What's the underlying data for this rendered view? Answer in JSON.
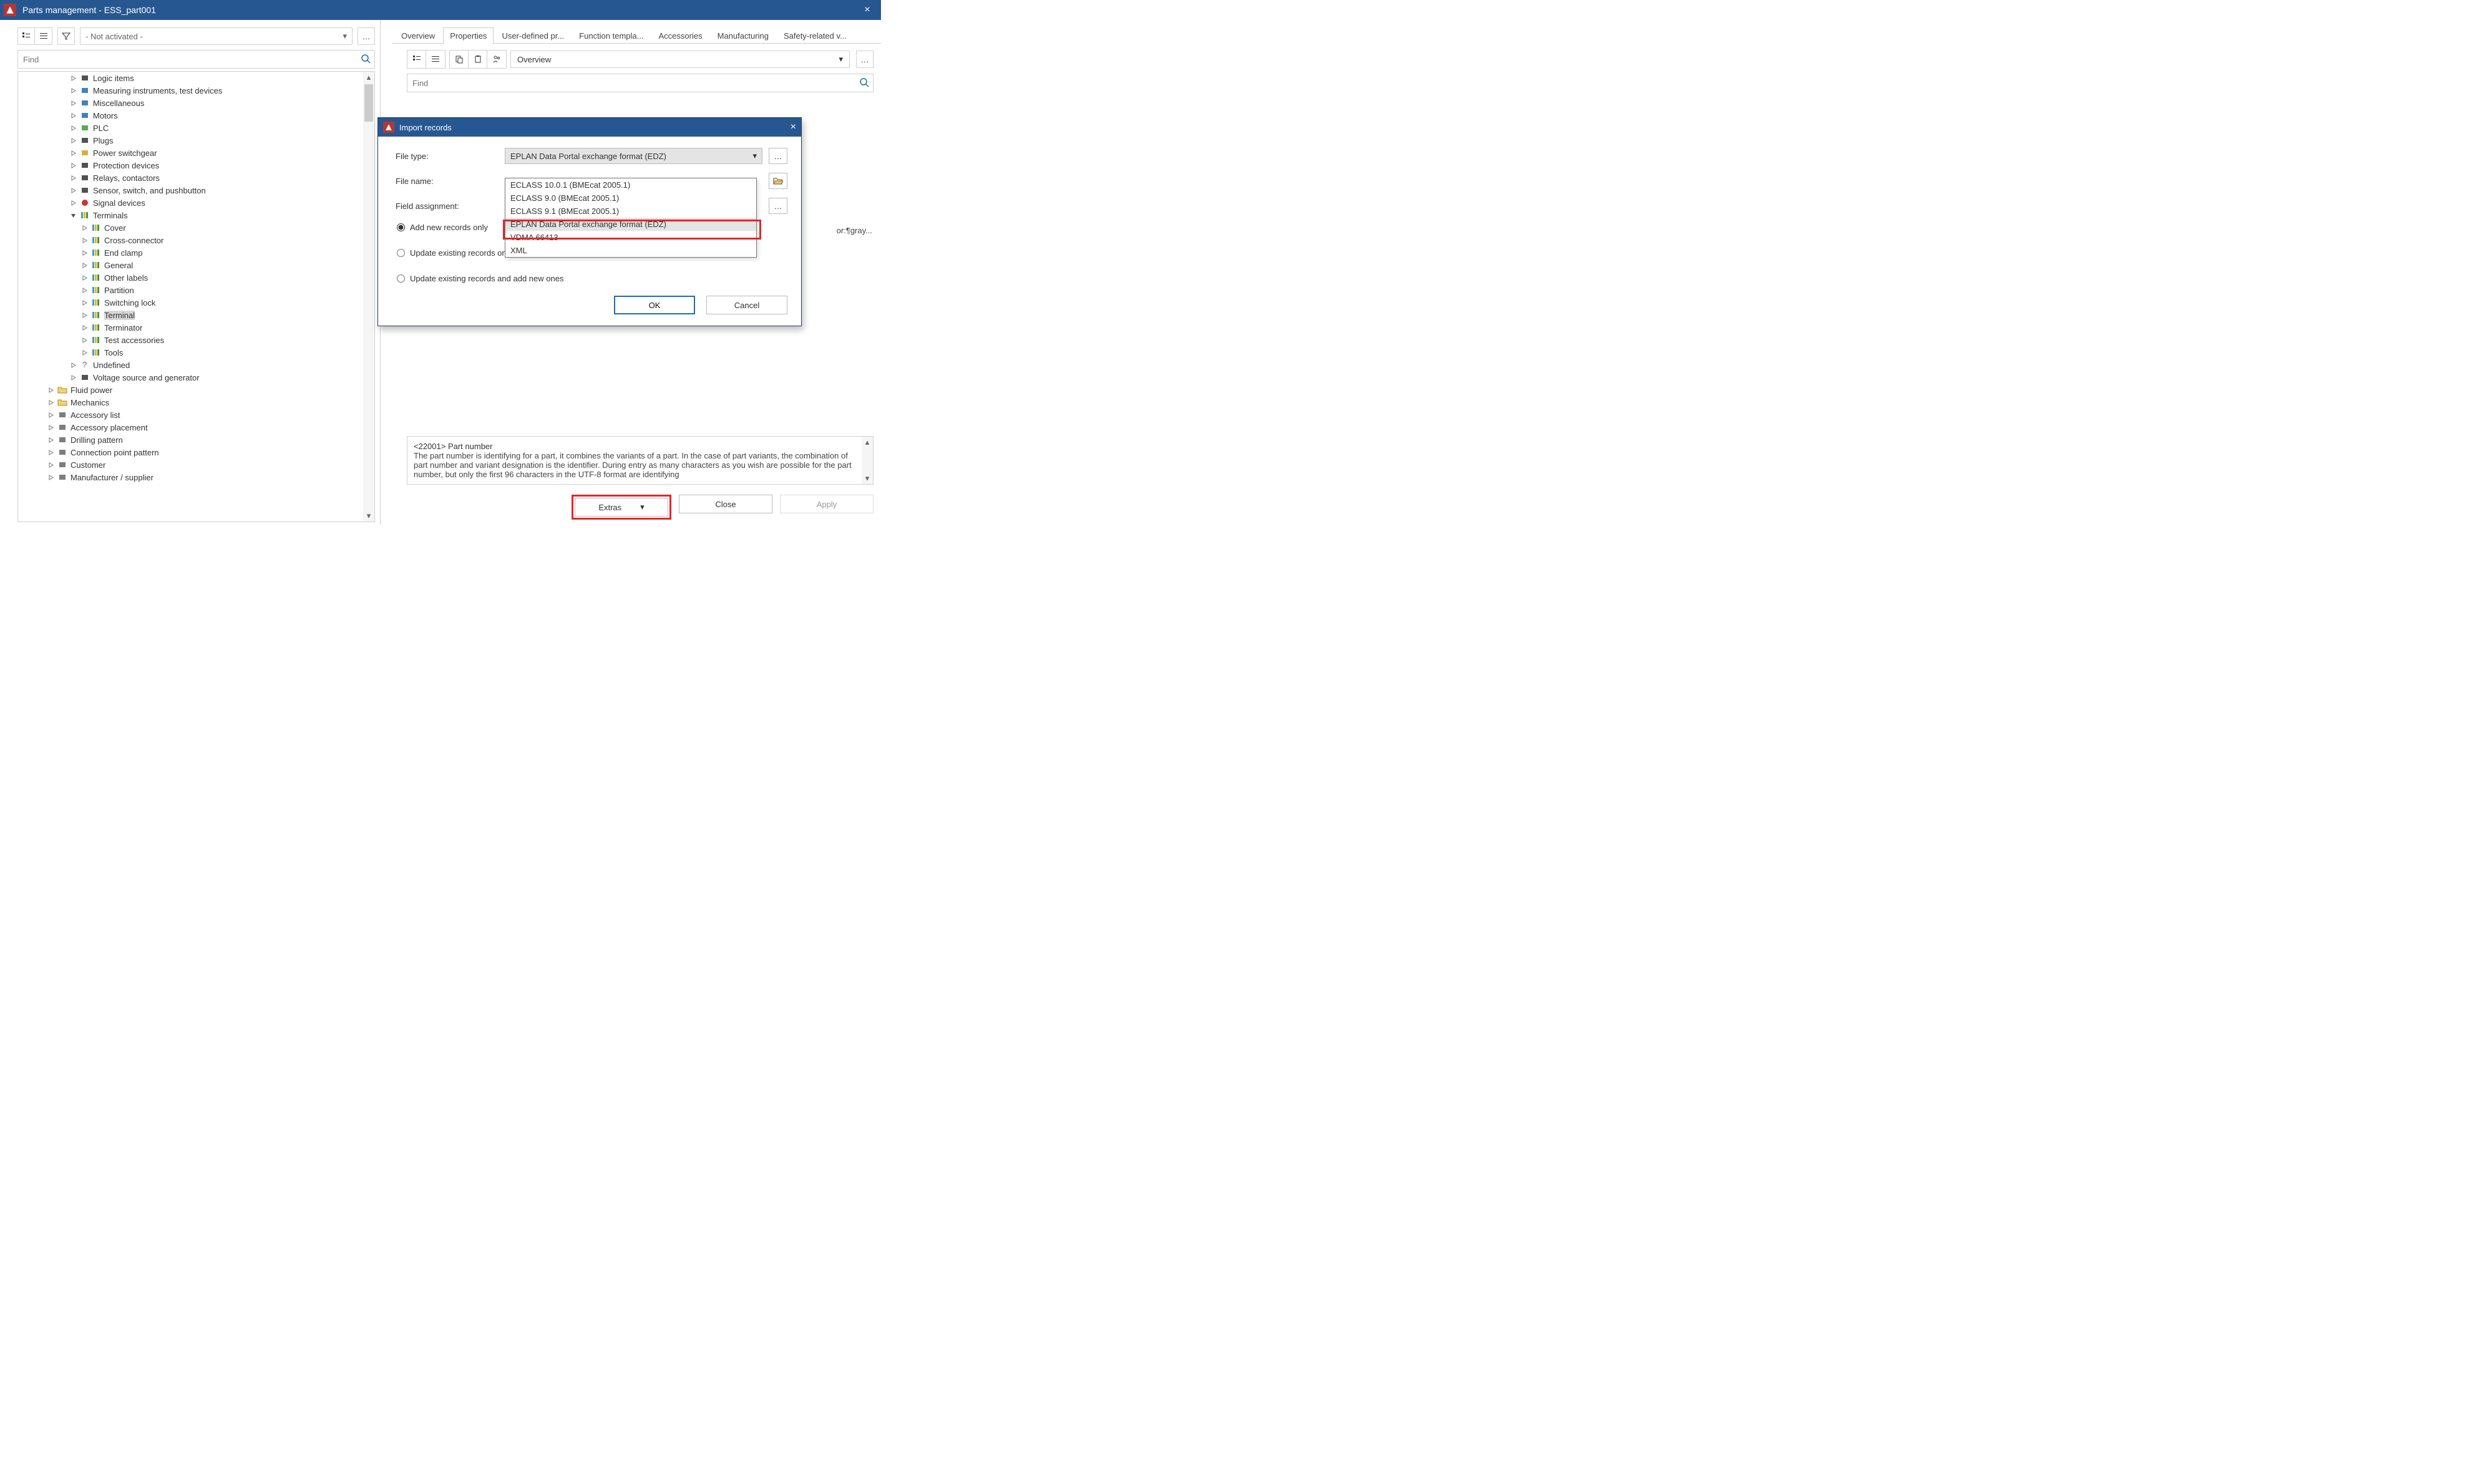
{
  "window": {
    "title": "Parts management - ESS_part001"
  },
  "left": {
    "filter_placeholder": "- Not activated -",
    "find_placeholder": "Find",
    "tree": [
      {
        "label": "Logic items",
        "icon": "logic"
      },
      {
        "label": "Measuring instruments, test devices",
        "icon": "measure"
      },
      {
        "label": "Miscellaneous",
        "icon": "misc"
      },
      {
        "label": "Motors",
        "icon": "motor"
      },
      {
        "label": "PLC",
        "icon": "plc"
      },
      {
        "label": "Plugs",
        "icon": "plug"
      },
      {
        "label": "Power switchgear",
        "icon": "switchgear"
      },
      {
        "label": "Protection devices",
        "icon": "protect"
      },
      {
        "label": "Relays, contactors",
        "icon": "relay"
      },
      {
        "label": "Sensor, switch, and pushbutton",
        "icon": "sensor"
      },
      {
        "label": "Signal devices",
        "icon": "signal"
      },
      {
        "label": "Terminals",
        "icon": "terminals",
        "expanded": true,
        "children": [
          {
            "label": "Cover"
          },
          {
            "label": "Cross-connector"
          },
          {
            "label": "End clamp"
          },
          {
            "label": "General"
          },
          {
            "label": "Other labels"
          },
          {
            "label": "Partition"
          },
          {
            "label": "Switching lock"
          },
          {
            "label": "Terminal",
            "selected": true
          },
          {
            "label": "Terminator"
          },
          {
            "label": "Test accessories"
          },
          {
            "label": "Tools"
          }
        ]
      },
      {
        "label": "Undefined",
        "icon": "undefined"
      },
      {
        "label": "Voltage source and generator",
        "icon": "voltage"
      }
    ],
    "tree_tail": [
      {
        "label": "Fluid power",
        "icon": "folder"
      },
      {
        "label": "Mechanics",
        "icon": "folder"
      },
      {
        "label": "Accessory list",
        "icon": "acclist"
      },
      {
        "label": "Accessory placement",
        "icon": "accplace"
      },
      {
        "label": "Drilling pattern",
        "icon": "drill"
      },
      {
        "label": "Connection point pattern",
        "icon": "connpt"
      },
      {
        "label": "Customer",
        "icon": "customer"
      },
      {
        "label": "Manufacturer / supplier",
        "icon": "manuf"
      }
    ]
  },
  "right": {
    "tabs": [
      "Overview",
      "Properties",
      "User-defined pr...",
      "Function templa...",
      "Accessories",
      "Manufacturing",
      "Safety-related v..."
    ],
    "active_tab": 1,
    "overview_dd": "Overview",
    "find_placeholder": "Find",
    "truncated_text": "or:¶gray...",
    "info_title": "<22001> Part number",
    "info_body": "The part number is identifying for a part, it combines the variants of a part. In the case of part variants, the combination of part number and variant designation is the identifier. During entry as many characters as you wish are possible for the part number, but only the first 96 characters in the UTF-8 format are identifying",
    "buttons": {
      "extras": "Extras",
      "close": "Close",
      "apply": "Apply"
    }
  },
  "modal": {
    "title": "Import records",
    "labels": {
      "file_type": "File type:",
      "file_name": "File name:",
      "field_assignment": "Field assignment:"
    },
    "file_type_value": "EPLAN Data Portal exchange format (EDZ)",
    "options": [
      "ECLASS 10.0.1 (BMEcat 2005.1)",
      "ECLASS 9.0 (BMEcat 2005.1)",
      "ECLASS 9.1 (BMEcat 2005.1)",
      "EPLAN Data Portal exchange format (EDZ)",
      "VDMA 66413",
      "XML"
    ],
    "selected_option": 3,
    "radios": {
      "add_new": "Add new records only",
      "update_only": "Update existing records only",
      "update_and_add": "Update existing records and add new ones"
    },
    "buttons": {
      "ok": "OK",
      "cancel": "Cancel"
    }
  }
}
